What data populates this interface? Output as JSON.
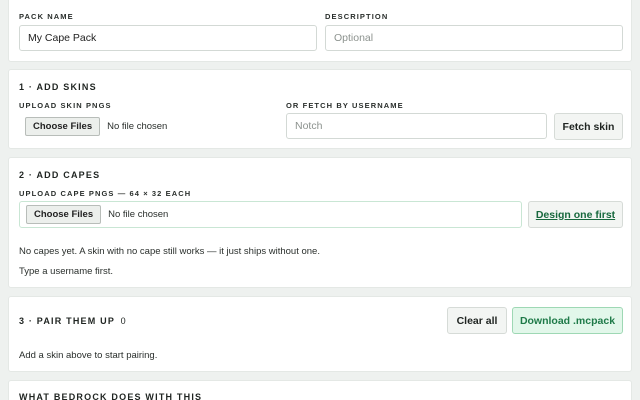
{
  "pack": {
    "name_label": "PACK NAME",
    "name_value": "My Cape Pack",
    "description_label": "DESCRIPTION",
    "description_placeholder": "Optional"
  },
  "skins": {
    "title": "1 · ADD SKINS",
    "upload_label": "UPLOAD SKIN PNGS",
    "choose_label": "Choose Files",
    "file_status": "No file chosen",
    "fetch_label": "OR FETCH BY USERNAME",
    "username_placeholder": "Notch",
    "fetch_button": "Fetch skin"
  },
  "capes": {
    "title": "2 · ADD CAPES",
    "upload_label": "UPLOAD CAPE PNGS — 64 × 32 EACH",
    "choose_label": "Choose Files",
    "file_status": "No file chosen",
    "design_button": "Design one first",
    "empty_note": "No capes yet. A skin with no cape still works — it just ships without one.",
    "username_note": "Type a username first."
  },
  "pair": {
    "title": "3 · PAIR THEM UP",
    "count": "0",
    "clear_button": "Clear all",
    "download_button": "Download .mcpack",
    "empty_note": "Add a skin above to start pairing."
  },
  "info": {
    "title": "WHAT BEDROCK DOES WITH THIS"
  },
  "colors": {
    "accent_green": "#1e7a48",
    "accent_green_bg": "#e2f7ea",
    "page_bg": "#eef1ef"
  }
}
